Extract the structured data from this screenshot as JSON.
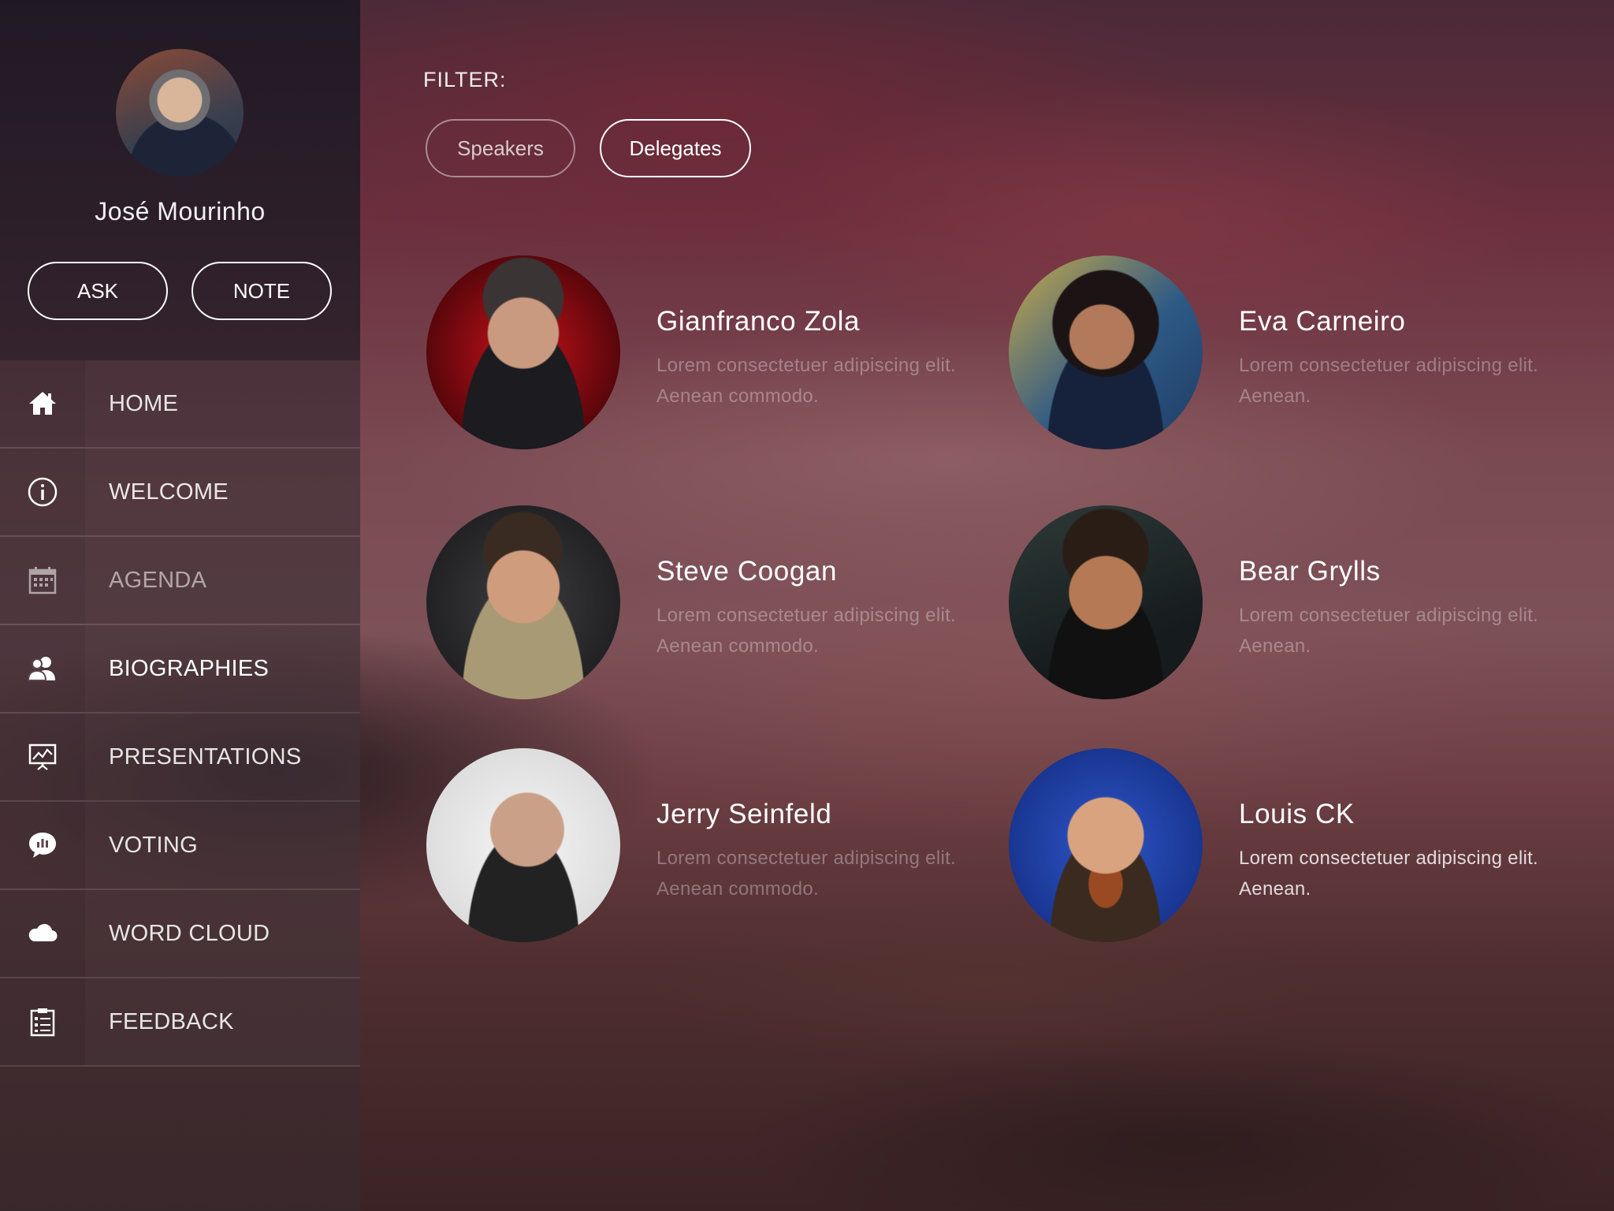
{
  "profile": {
    "name": "José Mourinho",
    "ask_label": "ASK",
    "note_label": "NOTE"
  },
  "menu": [
    {
      "label": "HOME",
      "icon": "home-icon",
      "state": "normal"
    },
    {
      "label": "WELCOME",
      "icon": "info-icon",
      "state": "normal"
    },
    {
      "label": "AGENDA",
      "icon": "calendar-icon",
      "state": "dim"
    },
    {
      "label": "BIOGRAPHIES",
      "icon": "people-icon",
      "state": "active"
    },
    {
      "label": "PRESENTATIONS",
      "icon": "presentation-icon",
      "state": "normal"
    },
    {
      "label": "VOTING",
      "icon": "chat-chart-icon",
      "state": "normal"
    },
    {
      "label": "WORD CLOUD",
      "icon": "cloud-icon",
      "state": "normal"
    },
    {
      "label": "FEEDBACK",
      "icon": "clipboard-icon",
      "state": "normal"
    }
  ],
  "filter": {
    "label": "FILTER:",
    "options": [
      "Speakers",
      "Delegates"
    ],
    "selected": "Delegates"
  },
  "people": [
    {
      "name": "Gianfranco Zola",
      "desc": "Lorem consectetuer adipiscing elit. Aenean commodo."
    },
    {
      "name": "Eva Carneiro",
      "desc": "Lorem consectetuer adipiscing elit. Aenean."
    },
    {
      "name": "Steve Coogan",
      "desc": "Lorem consectetuer adipiscing elit. Aenean commodo."
    },
    {
      "name": "Bear Grylls",
      "desc": "Lorem consectetuer adipiscing elit. Aenean."
    },
    {
      "name": "Jerry Seinfeld",
      "desc": "Lorem consectetuer adipiscing elit. Aenean commodo."
    },
    {
      "name": "Louis CK",
      "desc": "Lorem consectetuer adipiscing elit. Aenean."
    }
  ]
}
